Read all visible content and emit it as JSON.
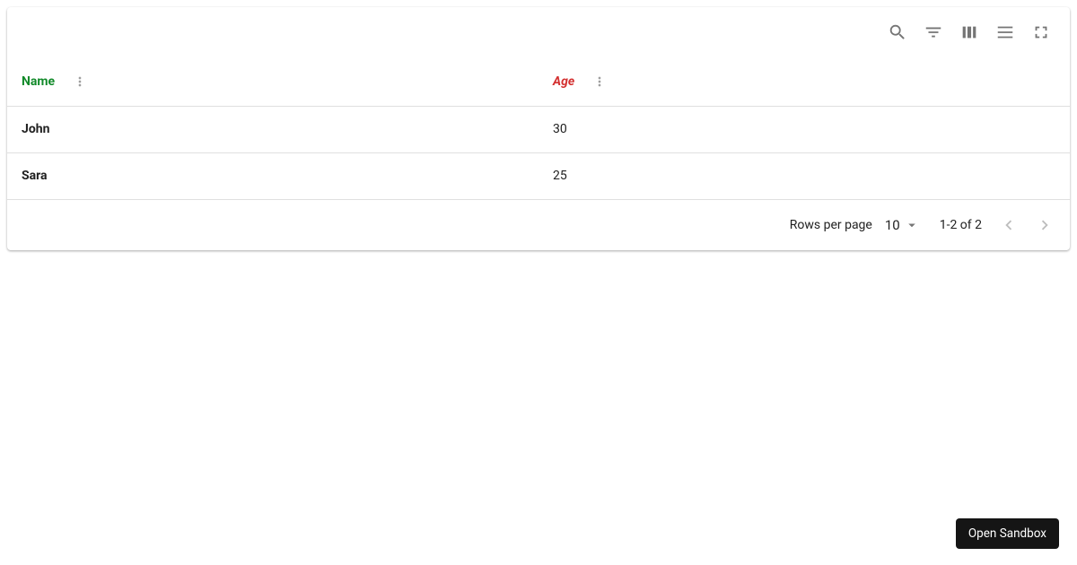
{
  "toolbar": {
    "icons": [
      "search",
      "filter",
      "columns",
      "density",
      "fullscreen"
    ]
  },
  "table": {
    "headers": {
      "name": "Name",
      "age": "Age"
    },
    "rows": [
      {
        "name": "John",
        "age": "30"
      },
      {
        "name": "Sara",
        "age": "25"
      }
    ]
  },
  "pagination": {
    "rows_per_page_label": "Rows per page",
    "rows_per_page_value": "10",
    "range_text": "1-2 of 2"
  },
  "sandbox": {
    "label": "Open Sandbox"
  }
}
